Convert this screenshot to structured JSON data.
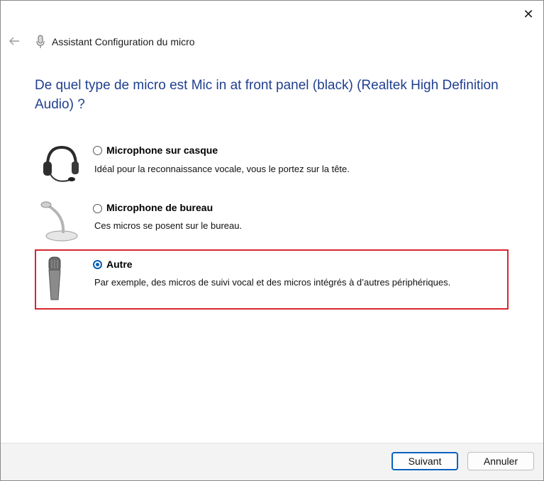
{
  "window": {
    "title": "Assistant Configuration du micro",
    "close_glyph": "✕",
    "back_icon": "arrow-left-icon",
    "app_icon": "microphone-icon"
  },
  "heading": "De quel type de micro est Mic in at front panel (black) (Realtek High Definition Audio) ?",
  "options": [
    {
      "label": "Microphone sur casque",
      "description": "Idéal pour la reconnaissance vocale, vous le portez sur la tête.",
      "icon": "headset-icon",
      "selected": false
    },
    {
      "label": "Microphone de bureau",
      "description": "Ces micros se posent sur le bureau.",
      "icon": "desk-microphone-icon",
      "selected": false
    },
    {
      "label": "Autre",
      "description": "Par exemple, des micros de suivi vocal et des micros intégrés à d’autres périphériques.",
      "icon": "handheld-microphone-icon",
      "selected": true
    }
  ],
  "buttons": {
    "next": "Suivant",
    "cancel": "Annuler"
  },
  "colors": {
    "heading": "#1f3f8f",
    "highlight": "#d6262e",
    "accent": "#0a62c0"
  }
}
